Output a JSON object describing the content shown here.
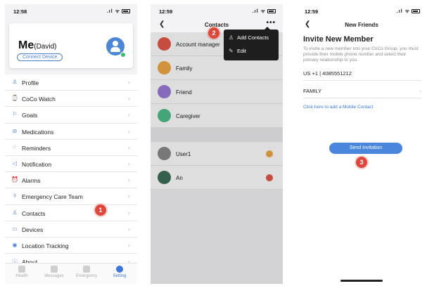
{
  "phone1": {
    "time": "12:58",
    "profile": {
      "name": "Me",
      "sub": "(David)",
      "connect_label": "Connect Device"
    },
    "menu": [
      {
        "label": "Profile",
        "icon": "person-icon"
      },
      {
        "label": "CoCo Watch",
        "icon": "watch-icon"
      },
      {
        "label": "Goals",
        "icon": "flag-icon"
      },
      {
        "label": "Medications",
        "icon": "pill-icon"
      },
      {
        "label": "Reminders",
        "icon": "bell-icon"
      },
      {
        "label": "Notification",
        "icon": "megaphone-icon"
      },
      {
        "label": "Alarms",
        "icon": "alarm-icon"
      },
      {
        "label": "Emergency Care Team",
        "icon": "team-icon"
      },
      {
        "label": "Contacts",
        "icon": "contacts-icon"
      },
      {
        "label": "Devices",
        "icon": "devices-icon"
      },
      {
        "label": "Location Tracking",
        "icon": "pin-icon"
      },
      {
        "label": "About",
        "icon": "info-icon"
      }
    ],
    "tabs": [
      {
        "label": "Health"
      },
      {
        "label": "Messages"
      },
      {
        "label": "Emergency"
      },
      {
        "label": "Setting",
        "active": true
      }
    ],
    "badge": "1"
  },
  "phone2": {
    "time": "12:59",
    "title": "Contacts",
    "groups": [
      {
        "label": "Account manager",
        "color": "#e4574a"
      },
      {
        "label": "Family",
        "color": "#f0a848"
      },
      {
        "label": "Friend",
        "color": "#9b7ad8"
      },
      {
        "label": "Caregiver",
        "color": "#4fbf8a"
      }
    ],
    "users": [
      {
        "label": "User1",
        "dot_color": "#f0a848"
      },
      {
        "label": "An",
        "dot_color": "#e4574a"
      }
    ],
    "popup": {
      "add_label": "Add Contacts",
      "edit_label": "Edit"
    },
    "badge": "2"
  },
  "phone3": {
    "time": "12:59",
    "title": "New Friends",
    "heading": "Invite New Member",
    "description": "To invite a new member into your CoCo Group, you must provide their mobile phone number and select their primary relationship to you.",
    "phone_number": "US +1 | 4085551212",
    "relationship": "FAMILY",
    "link_label": "Click here to add a Mobile Contact",
    "send_label": "Send Invitation",
    "badge": "3"
  },
  "colors": {
    "accent": "#3b78d8",
    "badge": "#e0473b",
    "popup_bg": "#1e1e1e"
  }
}
